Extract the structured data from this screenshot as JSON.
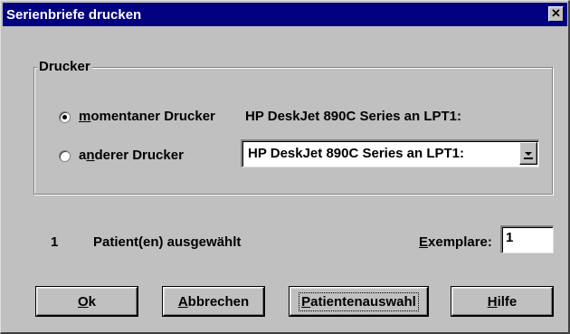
{
  "window": {
    "title": "Serienbriefe drucken",
    "close_symbol": "✕"
  },
  "printer_group": {
    "legend": "Drucker",
    "current_printer": {
      "label_mnemonic": "m",
      "label_rest": "omentaner Drucker",
      "checked": true,
      "value": "HP DeskJet 890C Series an LPT1:"
    },
    "other_printer": {
      "label_pre": "a",
      "label_mnemonic": "n",
      "label_rest": "derer Drucker",
      "checked": false,
      "selected_value": "HP DeskJet 890C Series an LPT1:"
    }
  },
  "selection": {
    "count": "1",
    "text": "Patient(en) ausgewählt"
  },
  "copies": {
    "label_mnemonic": "E",
    "label_rest": "xemplare:",
    "value": "1"
  },
  "buttons": {
    "ok_mnemonic": "O",
    "ok_rest": "k",
    "cancel_mnemonic": "A",
    "cancel_rest": "bbrechen",
    "patient_mnemonic": "P",
    "patient_rest": "atientenauswahl",
    "help_mnemonic": "H",
    "help_rest": "ilfe"
  },
  "colors": {
    "titlebar": "#000080",
    "face": "#c0c0c0"
  }
}
